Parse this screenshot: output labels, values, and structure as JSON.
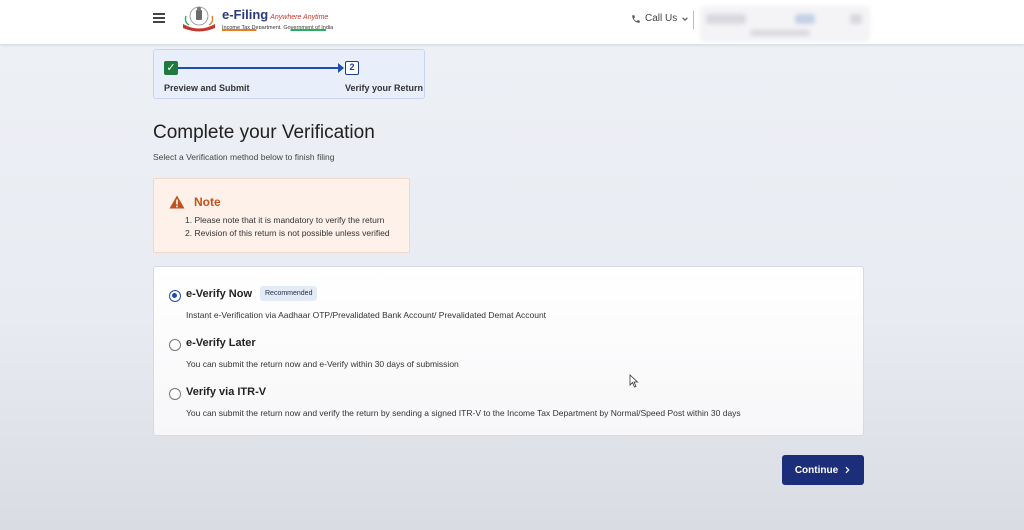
{
  "header": {
    "logo_main": "e-Filing",
    "logo_tagline": "Anywhere Anytime",
    "logo_sub": "Income Tax Department, Government of India",
    "call_us_label": "Call Us",
    "icons": [
      "hamburger-icon",
      "phone-icon",
      "chevron-down-icon"
    ]
  },
  "stepper": {
    "step1_label": "Preview and Submit",
    "step2_number": "2",
    "step2_label": "Verify your Return",
    "colors": {
      "completed": "#1f7a3e",
      "line": "#1e4ea8"
    }
  },
  "main": {
    "title": "Complete your Verification",
    "subtitle": "Select a Verification method below to finish filing"
  },
  "note": {
    "title": "Note",
    "items": [
      "1. Please note that it is mandatory to verify the return",
      "2. Revision of this return is not possible unless verified"
    ],
    "icon": "warning-icon"
  },
  "options": [
    {
      "title": "e-Verify Now",
      "badge": "Recommended",
      "desc": "Instant e-Verification via Aadhaar OTP/Prevalidated Bank Account/ Prevalidated Demat Account",
      "selected": true
    },
    {
      "title": "e-Verify Later",
      "desc": "You can submit the return now and e-Verify within 30 days of submission",
      "selected": false
    },
    {
      "title": "Verify via ITR-V",
      "desc": "You can submit the return now and verify the return by sending a signed ITR-V to the Income Tax Department by Normal/Speed Post within 30 days",
      "selected": false
    }
  ],
  "footer": {
    "continue_label": "Continue"
  },
  "colors": {
    "primary": "#1c2e7a",
    "note_bg": "#fdf1ea",
    "note_title": "#c0531b"
  }
}
